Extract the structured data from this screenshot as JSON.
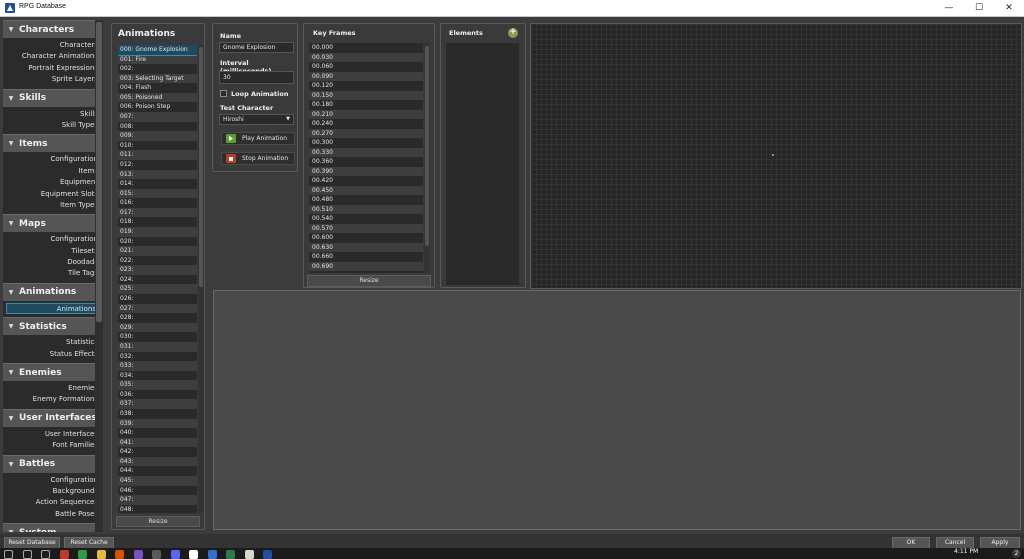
{
  "window": {
    "title": "RPG Database",
    "minimize": "—",
    "maximize": "☐",
    "close": "✕"
  },
  "sidebar": {
    "sections": [
      {
        "label": "Characters",
        "items": [
          "Characters",
          "Character Animations",
          "Portrait Expressions",
          "Sprite Layers"
        ]
      },
      {
        "label": "Skills",
        "items": [
          "Skills",
          "Skill Types"
        ]
      },
      {
        "label": "Items",
        "items": [
          "Configuration",
          "Items",
          "Equipment",
          "Equipment Slots",
          "Item Types"
        ]
      },
      {
        "label": "Maps",
        "items": [
          "Configuration",
          "Tilesets",
          "Doodads",
          "Tile Tags"
        ]
      },
      {
        "label": "Animations",
        "items": [
          "Animations"
        ],
        "selected": "Animations"
      },
      {
        "label": "Statistics",
        "items": [
          "Statistics",
          "Status Effects"
        ]
      },
      {
        "label": "Enemies",
        "items": [
          "Enemies",
          "Enemy Formations"
        ]
      },
      {
        "label": "User Interfaces",
        "items": [
          "User Interfaces",
          "Font Families"
        ]
      },
      {
        "label": "Battles",
        "items": [
          "Configuration",
          "Backgrounds",
          "Action Sequences",
          "Battle Poses"
        ]
      },
      {
        "label": "System",
        "items": []
      }
    ]
  },
  "animations": {
    "title": "Animations",
    "selected_index": 0,
    "items": [
      "000: Gnome Explosion",
      "001: Fire",
      "002:",
      "003: Selecting Target",
      "004: Flash",
      "005: Poisoned",
      "006: Poison Step",
      "007:",
      "008:",
      "009:",
      "010:",
      "011:",
      "012:",
      "013:",
      "014:",
      "015:",
      "016:",
      "017:",
      "018:",
      "019:",
      "020:",
      "021:",
      "022:",
      "023:",
      "024:",
      "025:",
      "026:",
      "027:",
      "028:",
      "029:",
      "030:",
      "031:",
      "032:",
      "033:",
      "034:",
      "035:",
      "036:",
      "037:",
      "038:",
      "039:",
      "040:",
      "041:",
      "042:",
      "043:",
      "044:",
      "045:",
      "046:",
      "047:",
      "048:"
    ],
    "resize_label": "Resize"
  },
  "properties": {
    "name_label": "Name",
    "name_value": "Gnome Explosion",
    "interval_label": "Interval (milliseconds)",
    "interval_value": "30",
    "loop_label": "Loop Animation",
    "loop_checked": false,
    "test_character_label": "Test Character",
    "test_character_value": "Hiroshi",
    "play_label": "Play Animation",
    "stop_label": "Stop Animation"
  },
  "keyframes": {
    "title": "Key Frames",
    "items": [
      "00.000",
      "00.030",
      "00.060",
      "00.090",
      "00.120",
      "00.150",
      "00.180",
      "00.210",
      "00.240",
      "00.270",
      "00.300",
      "00.330",
      "00.360",
      "00.390",
      "00.420",
      "00.450",
      "00.480",
      "00.510",
      "00.540",
      "00.570",
      "00.600",
      "00.630",
      "00.660",
      "00.690"
    ],
    "resize_label": "Resize"
  },
  "elements": {
    "title": "Elements",
    "add_symbol": "+"
  },
  "footer": {
    "reset_database": "Reset Database",
    "reset_cache": "Reset Cache",
    "ok": "OK",
    "cancel": "Cancel",
    "apply": "Apply"
  },
  "taskbar": {
    "clock": "4:11 PM",
    "notification_count": "2",
    "icons": [
      "start-icon",
      "search-icon",
      "task-view-icon",
      "calendar-icon",
      "chrome-icon",
      "file-explorer-icon",
      "media-player-icon",
      "visual-studio-icon",
      "app-icon",
      "discord-icon",
      "github-icon",
      "app-icon",
      "steam-icon",
      "notepad-icon",
      "rpg-database-icon"
    ],
    "icon_colors": [
      "#1b1b1b",
      "#1b1b1b",
      "#1b1b1b",
      "#c0392b",
      "#2f9a4a",
      "#e5b93c",
      "#d35400",
      "#7b4fbf",
      "#5a5a5a",
      "#5865f2",
      "#ffffff",
      "#2f6fcf",
      "#2b7a4b",
      "#d8d8c8",
      "#1e4fa3"
    ]
  }
}
